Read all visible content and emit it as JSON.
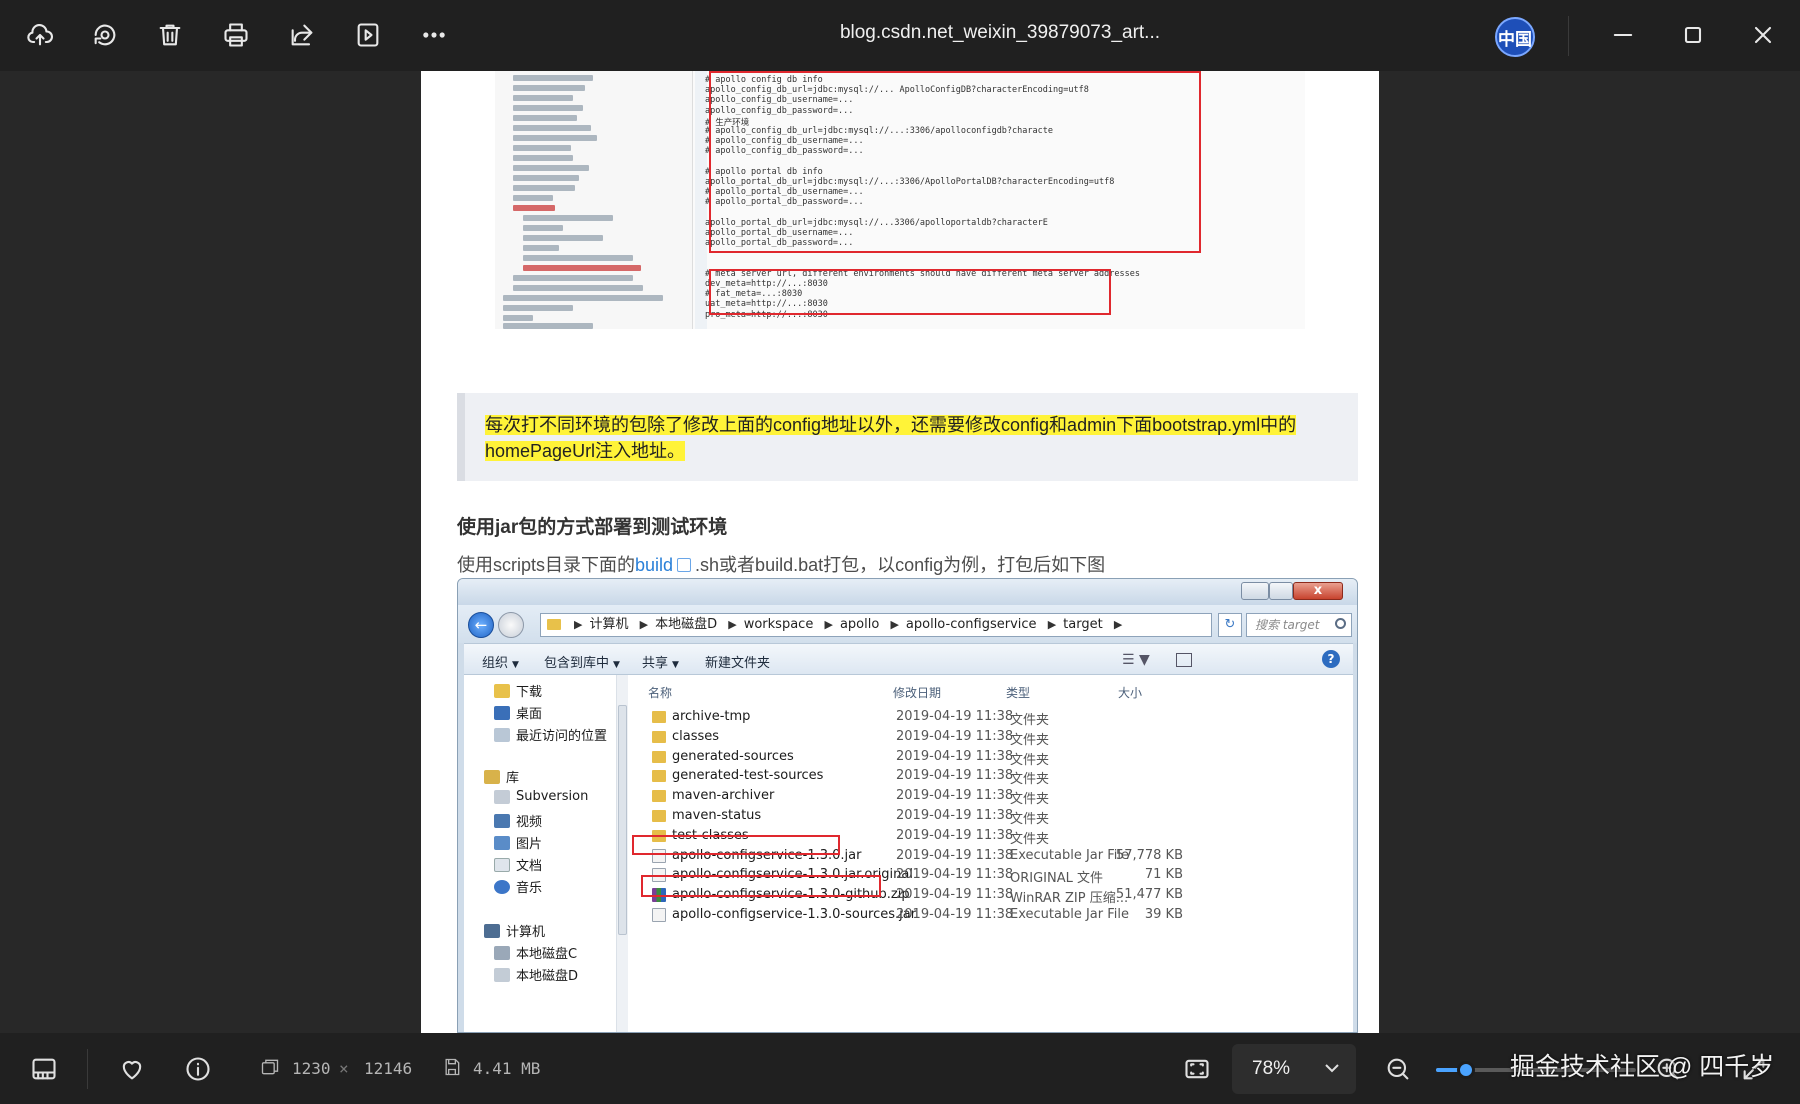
{
  "toolbar": {
    "title": "blog.csdn.net_weixin_39879073_art...",
    "ime_label": "中国"
  },
  "document": {
    "highlight_text": "每次打不同环境的包除了修改上面的config地址以外，还需要修改config和admin下面bootstrap.yml中的homePageUrl注入地址。",
    "heading": "使用jar包的方式部署到测试环境",
    "para_prefix": "使用scripts目录下面的",
    "para_link": "build",
    "para_suffix": ".sh或者build.bat打包，以config为例，打包后如下图",
    "code_lines": [
      "# apollo config db info",
      "apollo_config_db_url=jdbc:mysql://... ApolloConfigDB?characterEncoding=utf8",
      "apollo_config_db_username=...",
      "apollo_config_db_password=...",
      "# 生产环境",
      "# apollo_config_db_url=jdbc:mysql://...:3306/apolloconfigdb?characte",
      "# apollo_config_db_username=...",
      "# apollo_config_db_password=...",
      "",
      "# apollo portal db info",
      "apollo_portal_db_url=jdbc:mysql://...:3306/ApolloPortalDB?characterEncoding=utf8",
      "# apollo_portal_db_username=...",
      "# apollo_portal_db_password=...",
      "",
      "apollo_portal_db_url=jdbc:mysql://...3306/apolloportaldb?characterE",
      "apollo_portal_db_username=...",
      "apollo_portal_db_password=...",
      "",
      "",
      "# meta server url, different environments should have different meta server addresses",
      "dev_meta=http://...:8030",
      "# fat_meta=...:8030",
      "uat_meta=http://...:8030",
      "pro_meta=http://...:8030"
    ]
  },
  "explorer": {
    "breadcrumbs": [
      "计算机",
      "本地磁盘D",
      "workspace",
      "apollo",
      "apollo-configservice",
      "target"
    ],
    "search_placeholder": "搜索 target",
    "commands": [
      "组织",
      "包含到库中",
      "共享",
      "新建文件夹"
    ],
    "nav_items": [
      "下载",
      "桌面",
      "最近访问的位置",
      "库",
      "Subversion",
      "视频",
      "图片",
      "文档",
      "音乐",
      "计算机",
      "本地磁盘C",
      "本地磁盘D"
    ],
    "columns": [
      "名称",
      "修改日期",
      "类型",
      "大小"
    ],
    "files": [
      {
        "name": "archive-tmp",
        "date": "2019-04-19 11:38",
        "type": "文件夹",
        "size": "",
        "icon": "folder"
      },
      {
        "name": "classes",
        "date": "2019-04-19 11:38",
        "type": "文件夹",
        "size": "",
        "icon": "folder"
      },
      {
        "name": "generated-sources",
        "date": "2019-04-19 11:38",
        "type": "文件夹",
        "size": "",
        "icon": "folder"
      },
      {
        "name": "generated-test-sources",
        "date": "2019-04-19 11:38",
        "type": "文件夹",
        "size": "",
        "icon": "folder"
      },
      {
        "name": "maven-archiver",
        "date": "2019-04-19 11:38",
        "type": "文件夹",
        "size": "",
        "icon": "folder"
      },
      {
        "name": "maven-status",
        "date": "2019-04-19 11:38",
        "type": "文件夹",
        "size": "",
        "icon": "folder"
      },
      {
        "name": "test-classes",
        "date": "2019-04-19 11:38",
        "type": "文件夹",
        "size": "",
        "icon": "folder"
      },
      {
        "name": "apollo-configservice-1.3.0.jar",
        "date": "2019-04-19 11:38",
        "type": "Executable Jar File",
        "size": "57,778 KB",
        "icon": "doc"
      },
      {
        "name": "apollo-configservice-1.3.0.jar.original",
        "date": "2019-04-19 11:38",
        "type": "ORIGINAL 文件",
        "size": "71 KB",
        "icon": "doc"
      },
      {
        "name": "apollo-configservice-1.3.0-github.zip",
        "date": "2019-04-19 11:38",
        "type": "WinRAR ZIP 压缩...",
        "size": "51,477 KB",
        "icon": "zip"
      },
      {
        "name": "apollo-configservice-1.3.0-sources.jar",
        "date": "2019-04-19 11:38",
        "type": "Executable Jar File",
        "size": "39 KB",
        "icon": "doc"
      }
    ]
  },
  "status": {
    "dimensions_w": "1230",
    "dimensions_x": "×",
    "dimensions_h": "12146",
    "file_size": "4.41 MB",
    "zoom": "78%",
    "zoom_fraction": 0.15,
    "watermark": "掘金技术社区 @ 四千岁"
  },
  "colors": {
    "highlight": "#fff338",
    "link": "#2a80d8",
    "accent": "#4aa3ff",
    "red_box": "#e0282e"
  }
}
